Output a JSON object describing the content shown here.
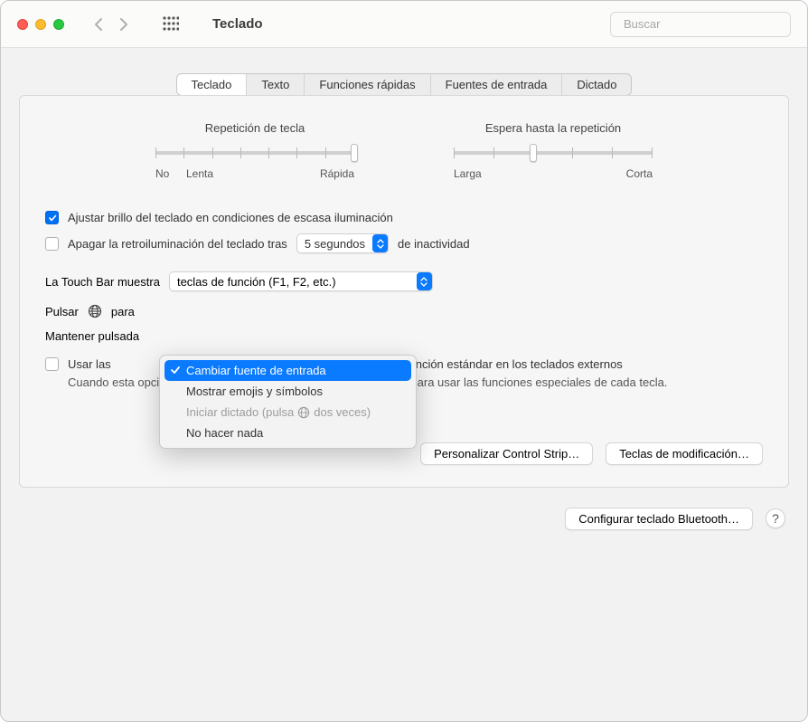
{
  "window": {
    "title": "Teclado",
    "search_placeholder": "Buscar"
  },
  "tabs": [
    {
      "label": "Teclado",
      "active": true
    },
    {
      "label": "Texto",
      "active": false
    },
    {
      "label": "Funciones rápidas",
      "active": false
    },
    {
      "label": "Fuentes de entrada",
      "active": false
    },
    {
      "label": "Dictado",
      "active": false
    }
  ],
  "sliders": {
    "key_repeat": {
      "title": "Repetición de tecla",
      "left_label": "No",
      "mid_label": "Lenta",
      "right_label": "Rápida",
      "ticks": 8,
      "value_index": 7
    },
    "delay_repeat": {
      "title": "Espera hasta la repetición",
      "left_label": "Larga",
      "right_label": "Corta",
      "ticks": 6,
      "value_index": 2
    }
  },
  "options": {
    "adjust_brightness": {
      "label": "Ajustar brillo del teclado en condiciones de escasa iluminación",
      "checked": true
    },
    "turn_off_backlight": {
      "label_prefix": "Apagar la retroiluminación del teclado tras",
      "select_value": "5 segundos",
      "label_suffix": "de inactividad",
      "checked": false
    },
    "touch_bar": {
      "label": "La Touch Bar muestra",
      "select_value": "teclas de función (F1, F2, etc.)"
    },
    "press_globe": {
      "label": "Pulsar",
      "suffix": "para"
    },
    "hold_globe": {
      "label": "Mantener pulsada"
    },
    "use_fn_keys": {
      "label_visible_prefix": "Usar las",
      "label_visible_suffix": "s de función estándar en los teclados externos",
      "checked": false,
      "help_text": "Cuando esta opción está seleccionada, puedes pulsar la tecla Fn para usar las funciones especiales de cada tecla."
    }
  },
  "popup": {
    "items": [
      {
        "label": "Cambiar fuente de entrada",
        "selected": true
      },
      {
        "label": "Mostrar emojis y símbolos",
        "selected": false
      },
      {
        "label_prefix": "Iniciar dictado (pulsa",
        "label_suffix": "dos veces)",
        "has_globe": true,
        "disabled": true
      },
      {
        "label": "No hacer nada",
        "selected": false
      }
    ]
  },
  "buttons": {
    "customize_strip": "Personalizar Control Strip…",
    "modifier_keys": "Teclas de modificación…",
    "bluetooth": "Configurar teclado Bluetooth…",
    "help": "?"
  }
}
